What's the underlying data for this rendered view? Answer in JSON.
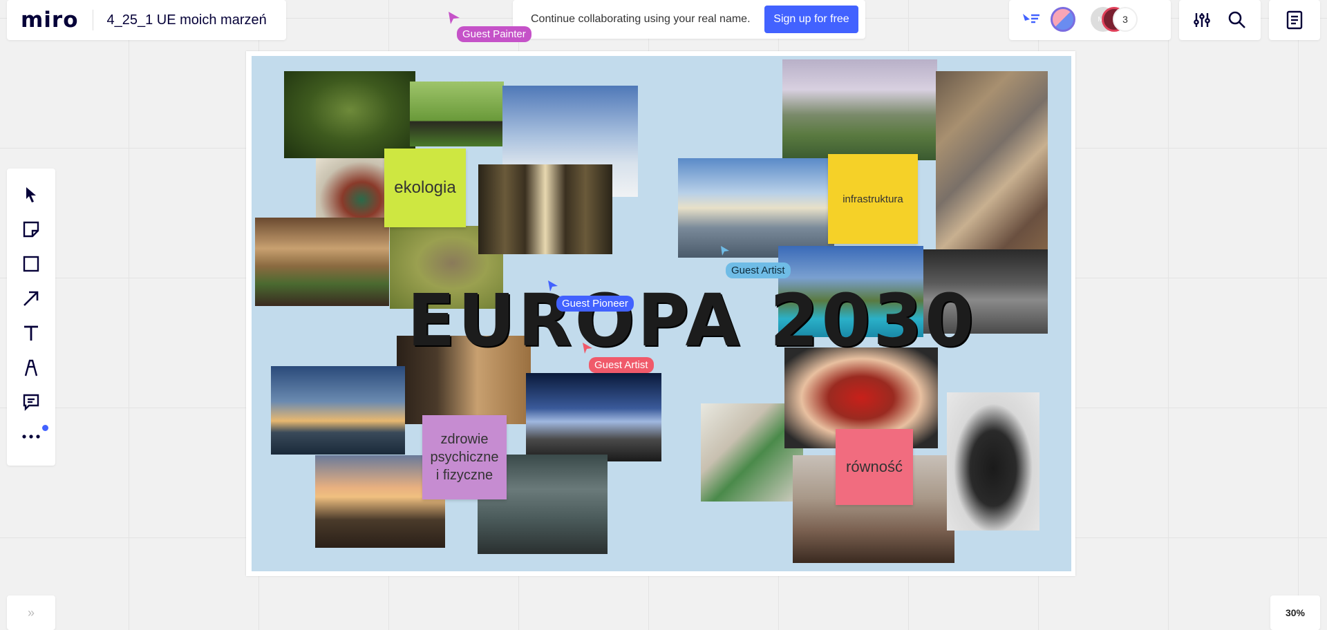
{
  "app": {
    "logo": "miro",
    "board_title": "4_25_1 UE moich marzeń"
  },
  "banner": {
    "text": "Continue collaborating using your real name.",
    "signup_label": "Sign up for free"
  },
  "collaborators": {
    "initials": "MK",
    "extra_count": "3"
  },
  "zoom": "30%",
  "board": {
    "headline": "EUROPA 2030",
    "stickies": {
      "ekologia": "ekologia",
      "infrastruktura": "infrastruktura",
      "zdrowie": "zdrowie psychiczne i fizyczne",
      "rownosc": "równość"
    },
    "cursors": {
      "painter": "Guest Painter",
      "artist1": "Guest Artist",
      "pioneer": "Guest Pioneer",
      "artist2": "Guest Artist"
    }
  },
  "colors": {
    "accent": "#4262ff",
    "sticky_green": "#cee741",
    "sticky_yellow": "#f5d128",
    "sticky_violet": "#c68cd1",
    "sticky_pink": "#f16c7f",
    "board_bg": "#c2dbec"
  }
}
